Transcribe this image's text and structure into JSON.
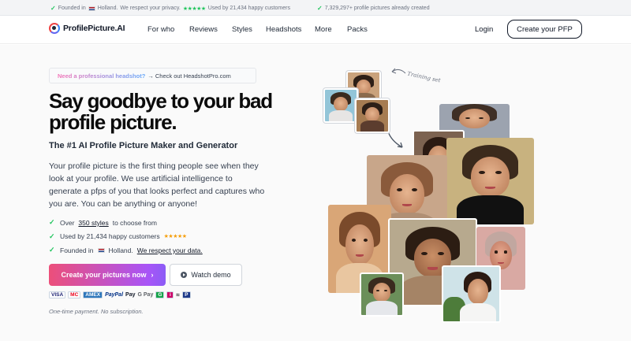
{
  "topbar": {
    "founded_prefix": "Founded in",
    "founded_country": "Holland.",
    "privacy": "We respect your privacy.",
    "stars": "★★★★★",
    "used_by": "Used by 21,434 happy customers",
    "pictures_created": "7,329,297+ profile pictures already created"
  },
  "nav": {
    "logo_text": "ProfilePicture.AI",
    "links": [
      "For who",
      "Reviews",
      "Styles",
      "Headshots",
      "More",
      "Packs"
    ],
    "login": "Login",
    "cta": "Create your PFP"
  },
  "hero": {
    "promo_highlight": "Need a professional headshot?",
    "promo_rest": "→ Check out HeadshotPro.com",
    "headline": "Say goodbye to your bad profile picture.",
    "subhead": "The #1 AI Profile Picture Maker and Generator",
    "description": "Your profile picture is the first thing people see when they look at your profile. We use artificial intelligence to generate a pfps of you that looks perfect and captures who you are. You can be anything or anyone!",
    "bullets": {
      "b1_prefix": "Over",
      "b1_link": "350 styles",
      "b1_suffix": "to choose from",
      "b2_text": "Used by 21,434 happy customers",
      "b2_stars": "★★★★★",
      "b3_prefix": "Founded in",
      "b3_country": "Holland.",
      "b3_link": "We respect your data."
    },
    "primary_button": "Create your pictures now",
    "primary_arrow": "›",
    "secondary_button": "Watch demo",
    "payment_methods": [
      "VISA",
      "MC",
      "AMEX",
      "PayPal",
      "Pay",
      "G Pay",
      "G",
      "i",
      "≈",
      "P"
    ],
    "note": "One-time payment. No subscription.",
    "training_label": "Training set"
  },
  "colors": {
    "accent_start": "#ec4f7a",
    "accent_end": "#8b5cf6",
    "check_green": "#22c55e",
    "star_gold": "#f59e0b"
  }
}
